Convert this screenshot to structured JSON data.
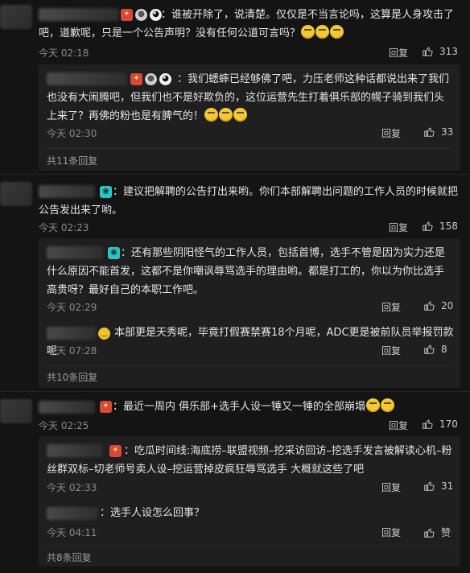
{
  "threads": [
    {
      "text": "：谁被开除了，说清楚。仅仅是不当言论吗，这算是人身攻击了吧，道歉呢，只是一个公告声明？没有任何公道可言吗？",
      "time": "今天 02:18",
      "reply_label": "回复",
      "likes": "313",
      "replies": [
        {
          "text": "：我们蟋蟀已经够佛了吧，力压老师这种话都说出来了我们也没有大闹腾吧，但我们也不是好欺负的，这位运营先生打着俱乐部的幌子骑到我们头上来了？再佛的粉也是有脾气的！",
          "time": "今天 02:30",
          "reply_label": "回复",
          "likes": "33"
        }
      ],
      "more": "共11条回复"
    },
    {
      "text": "：建议把解聘的公告打出来哟。你们本部解聘出问题的工作人员的时候就把公告发出来了哟。",
      "time": "今天 02:23",
      "reply_label": "回复",
      "likes": "158",
      "replies": [
        {
          "text": "：还有那些阴阳怪气的工作人员，包括首博，选手不管是因为实力还是什么原因不能首发，这都不是你嘲讽辱骂选手的理由哟。都是打工的，你以为你比选手高贵呀？最好自己的本职工作吧。",
          "time": "今天 02:29",
          "reply_label": "回复",
          "likes": "20"
        },
        {
          "text": "本部更是天秀呢，毕竟打假赛禁赛18个月呢，ADC更是被前队员举报罚款呢",
          "time": "今天 07:28",
          "reply_label": "回复",
          "likes": "8"
        }
      ],
      "more": "共10条回复"
    },
    {
      "text": "：最近一周内 俱乐部+选手人设一锤又一锤的全部崩塌",
      "time": "今天 02:25",
      "reply_label": "回复",
      "likes": "170",
      "replies": [
        {
          "text": "：吃瓜时间线:海底捞–联盟视频–挖采访回访–挖选手发言被解读心机–粉丝群双标–切老师号卖人设–挖运营掉皮疯狂辱骂选手 大概就这些了吧",
          "time": "今天 02:33",
          "reply_label": "回复",
          "likes": "31"
        },
        {
          "text": "：选手人设怎么回事？",
          "time": "今天 04:11",
          "reply_label": "回复",
          "likes": "赞"
        }
      ],
      "more": "共8条回复"
    }
  ]
}
